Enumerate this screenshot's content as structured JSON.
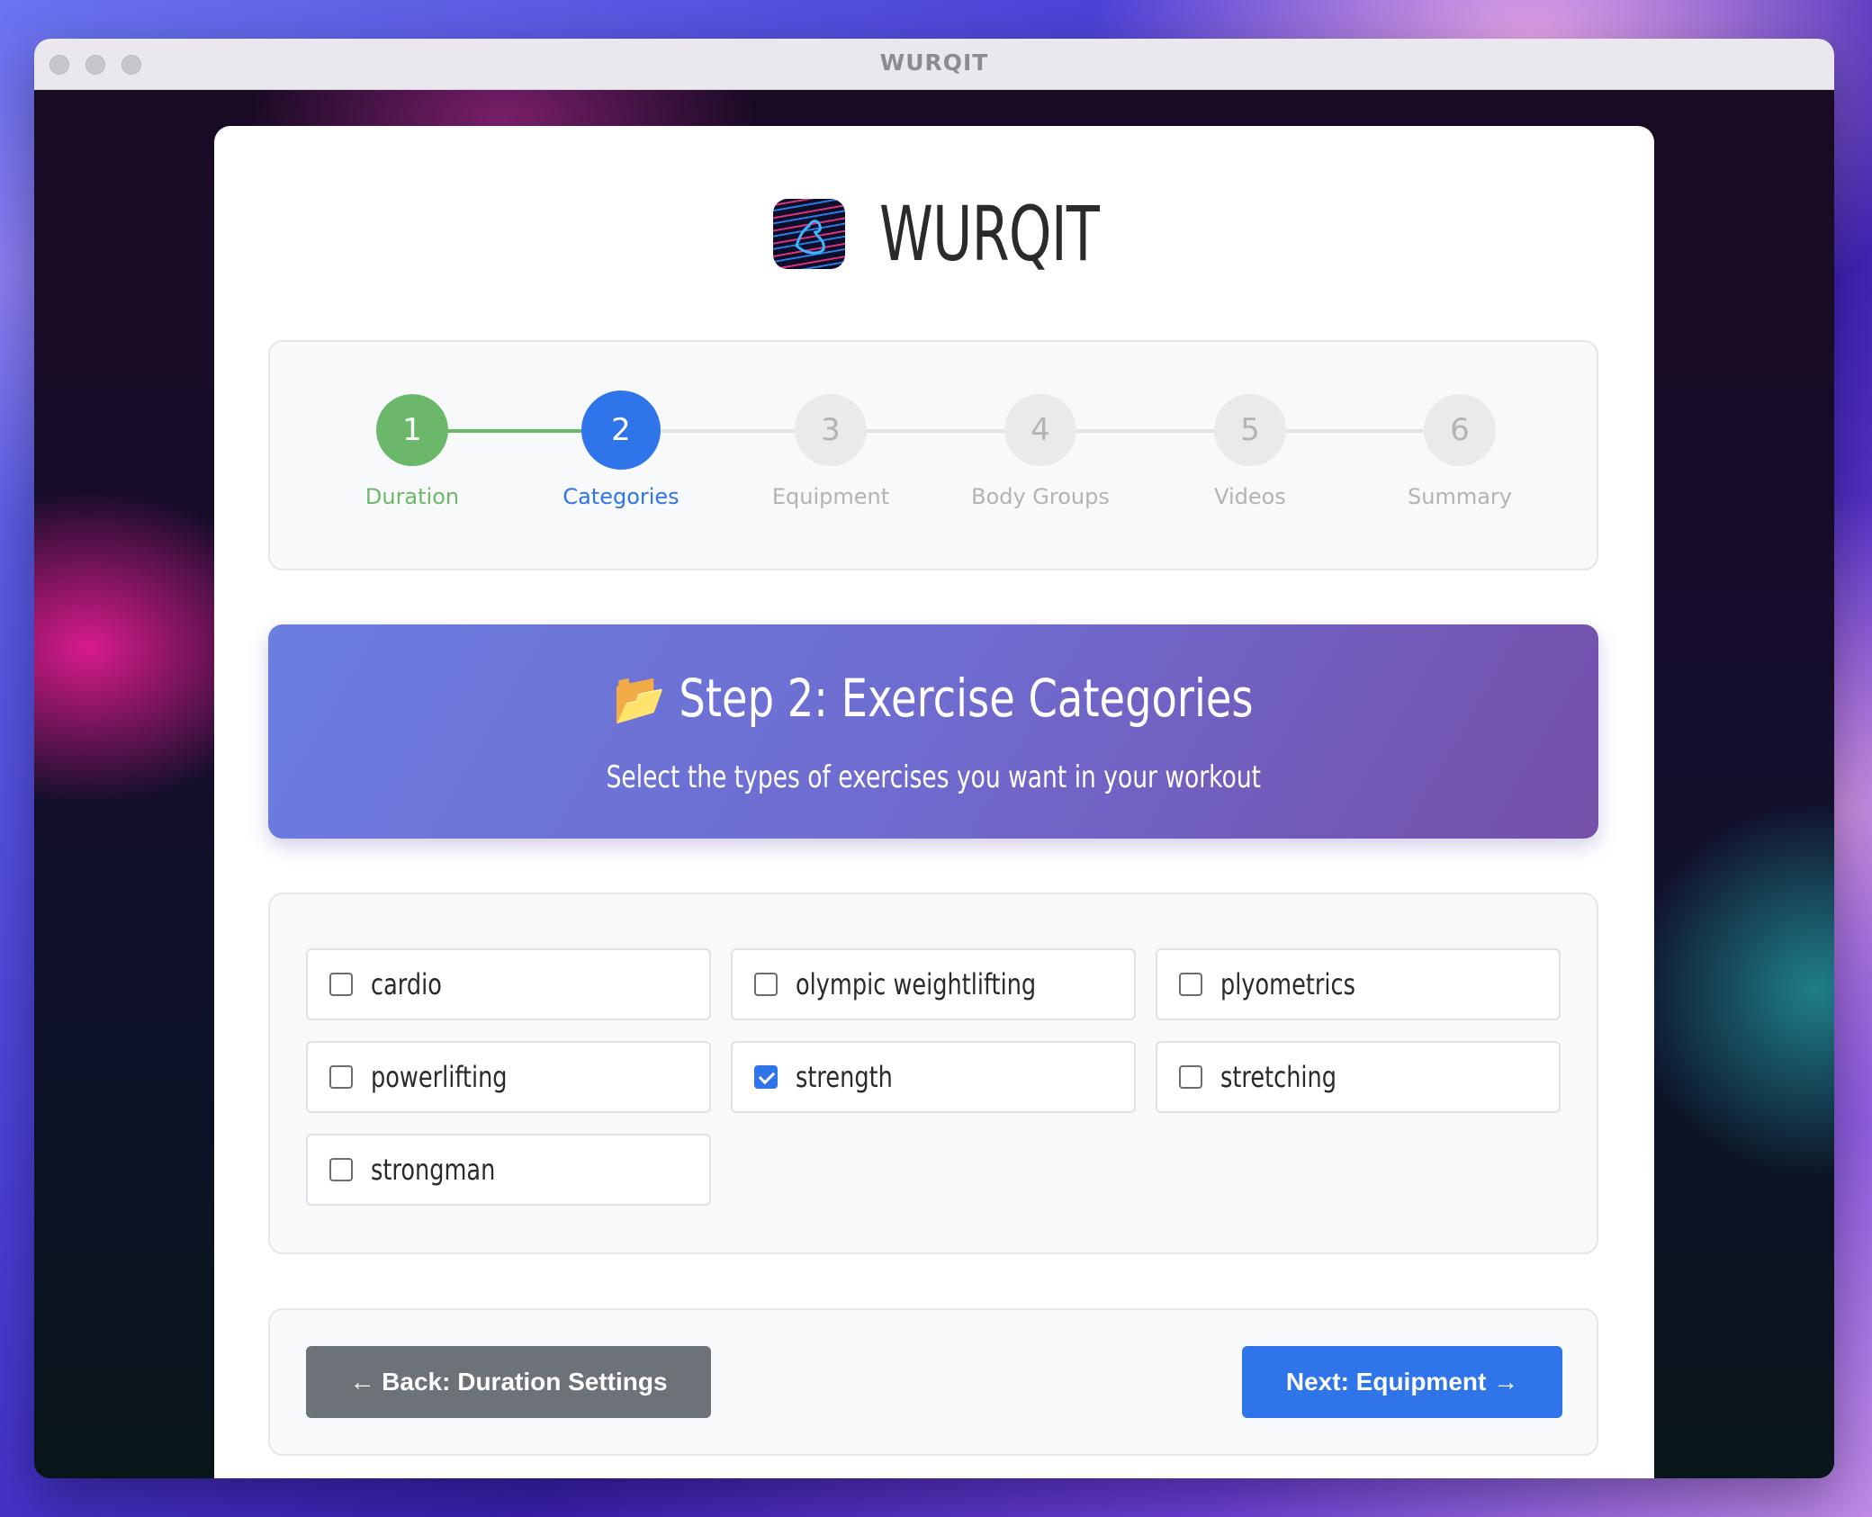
{
  "window": {
    "title": "WURQIT"
  },
  "brand": {
    "name": "WURQIT",
    "logo_icon": "flexed-bicep-icon"
  },
  "stepper": {
    "steps": [
      {
        "number": "1",
        "label": "Duration",
        "state": "completed",
        "color": "#6cb86a"
      },
      {
        "number": "2",
        "label": "Categories",
        "state": "active",
        "color": "#2f74e8"
      },
      {
        "number": "3",
        "label": "Equipment",
        "state": "pending",
        "color": "#b3b3b3"
      },
      {
        "number": "4",
        "label": "Body Groups",
        "state": "pending",
        "color": "#b3b3b3"
      },
      {
        "number": "5",
        "label": "Videos",
        "state": "pending",
        "color": "#b3b3b3"
      },
      {
        "number": "6",
        "label": "Summary",
        "state": "pending",
        "color": "#b3b3b3"
      }
    ]
  },
  "banner": {
    "icon": "📂",
    "title": "Step 2: Exercise Categories",
    "subtitle": "Select the types of exercises you want in your workout"
  },
  "categories": {
    "options": [
      {
        "label": "cardio",
        "checked": false
      },
      {
        "label": "olympic weightlifting",
        "checked": false
      },
      {
        "label": "plyometrics",
        "checked": false
      },
      {
        "label": "powerlifting",
        "checked": false
      },
      {
        "label": "strength",
        "checked": true
      },
      {
        "label": "stretching",
        "checked": false
      },
      {
        "label": "strongman",
        "checked": false
      }
    ]
  },
  "navigation": {
    "back_label": "← Back: Duration Settings",
    "next_label": "Next: Equipment →"
  },
  "colors": {
    "accent": "#2f74e8",
    "completed": "#6cb86a",
    "back_button": "#6c7278"
  }
}
